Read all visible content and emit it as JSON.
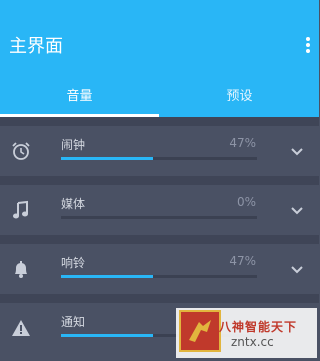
{
  "appbar": {
    "title": "主界面",
    "overflow_icon": "more-vert-icon"
  },
  "tabs": [
    {
      "label": "音量",
      "selected": true
    },
    {
      "label": "预设",
      "selected": false
    }
  ],
  "rows": [
    {
      "label": "闹钟",
      "percent": "47%",
      "level": 0.47,
      "icon": "alarm-clock-icon"
    },
    {
      "label": "媒体",
      "percent": "0%",
      "level": 0.0,
      "icon": "music-note-icon"
    },
    {
      "label": "响铃",
      "percent": "47%",
      "level": 0.47,
      "icon": "bell-icon"
    },
    {
      "label": "通知",
      "percent": "",
      "level": 0.47,
      "icon": "warning-icon"
    }
  ],
  "watermark": {
    "line1": "八神智能天下",
    "line2": "zntx.cc"
  },
  "colors": {
    "accent": "#29b6f6",
    "background": "#4a5164",
    "separator": "#3f4557"
  }
}
